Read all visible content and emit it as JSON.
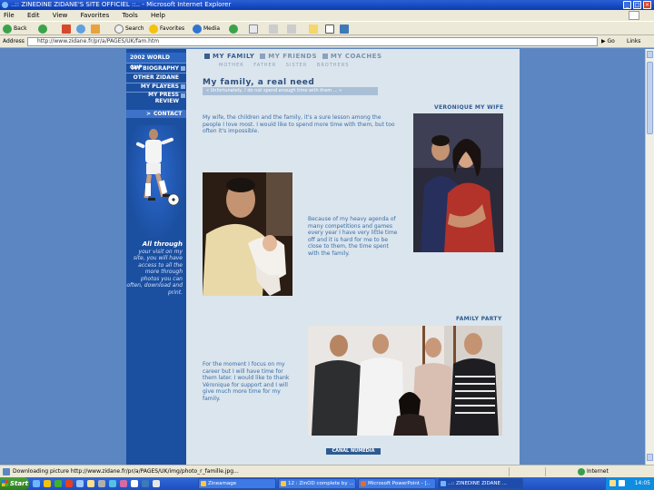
{
  "window": {
    "title": "..:: ZINEDINE ZIDANE'S SITE OFFICIEL ::.. - Microsoft Internet Explorer",
    "menu": [
      "File",
      "Edit",
      "View",
      "Favorites",
      "Tools",
      "Help"
    ]
  },
  "toolbar": {
    "back": "Back",
    "search": "Search",
    "favorites": "Favorites",
    "media": "Media"
  },
  "addressbar": {
    "label": "Address",
    "url": "http://www.zidane.fr/pr/a/PAGES/UK/fam.htm",
    "go": "Go",
    "links": "Links"
  },
  "sidenav": {
    "items": [
      "2002 WORLD CUP",
      "MY BIOGRAPHY",
      "OTHER ZIDANE",
      "MY PLAYERS",
      "MY PRESS REVIEW"
    ],
    "contact": "CONTACT",
    "caption_lead": "All through",
    "caption": "your visit on my site, you will have access to all the more through photos you can often, download and print."
  },
  "content": {
    "nav": {
      "family": "MY FAMILY",
      "friends": "MY FRIENDS",
      "coaches": "MY COACHES"
    },
    "subnav": [
      "MOTHER",
      "FATHER",
      "SISTER",
      "BROTHERS"
    ],
    "title": "My family, a real need",
    "quote": "« Unfortunately, I do not spend enough time with them ... »",
    "para1": "My wife, the children and the family, it's a sure lesson among the people I love most. I would like to spend more time with them, but too often it's impossible.",
    "para2": "Because of my heavy agenda of many competitions and games every year I have very little time off and it is hard for me to be close to them, the time spent with the family.",
    "para3": "For the moment I focus on my career but I will have time for them later. I would like to thank Véronique for support and I will give much more time for my family.",
    "caption_wife": "VERONIQUE MY WIFE",
    "caption_party": "FAMILY PARTY",
    "brand": "CANAL NUMEDIA"
  },
  "status": {
    "text": "Downloading picture http://www.zidane.fr/pr/a/PAGES/UK/img/photo_r_famille.jpg...",
    "zone": "Internet"
  },
  "taskbar": {
    "start": "Start",
    "tasks": [
      "Zineamage",
      "12 : ZinOD complete by ...",
      "Microsoft PowerPoint - [..",
      "..:: ZINEDINE ZIDANE ..."
    ],
    "clock": "14:05"
  },
  "colors": {
    "page_bg": "#5b86c2",
    "nav_bg": "#1b4fa0",
    "content_bg": "#dbe5ed",
    "title": "#2d4f7f",
    "text": "#3a6ea8"
  }
}
